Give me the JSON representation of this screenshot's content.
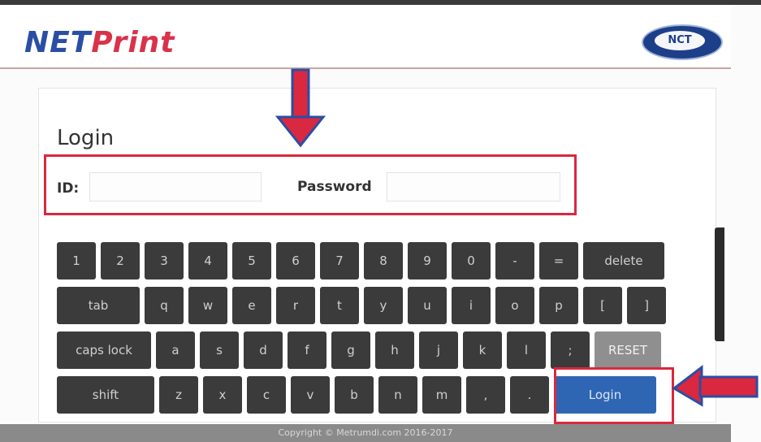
{
  "header": {
    "logo_part1": "NET",
    "logo_part2": "Print",
    "brand_badge": "NCT"
  },
  "login": {
    "title": "Login",
    "id_label": "ID:",
    "id_value": "",
    "password_label": "Password",
    "password_value": ""
  },
  "keyboard": {
    "row1": [
      "1",
      "2",
      "3",
      "4",
      "5",
      "6",
      "7",
      "8",
      "9",
      "0",
      "-",
      "=",
      "delete"
    ],
    "row2": [
      "tab",
      "q",
      "w",
      "e",
      "r",
      "t",
      "y",
      "u",
      "i",
      "o",
      "p",
      "[",
      "]"
    ],
    "row3": [
      "caps lock",
      "a",
      "s",
      "d",
      "f",
      "g",
      "h",
      "j",
      "k",
      "l",
      ";",
      "RESET"
    ],
    "row4": [
      "shift",
      "z",
      "x",
      "c",
      "v",
      "b",
      "n",
      "m",
      ",",
      ".",
      "Login"
    ]
  },
  "footer": {
    "copyright": "Copyright © Metrumdi.com 2016-2017"
  },
  "colors": {
    "annotation_red": "#d9283f",
    "annotation_blue": "#2b4ea5",
    "key_dark": "#3b3b3b",
    "key_reset": "#8f8f8f",
    "key_login": "#2f66b3"
  }
}
